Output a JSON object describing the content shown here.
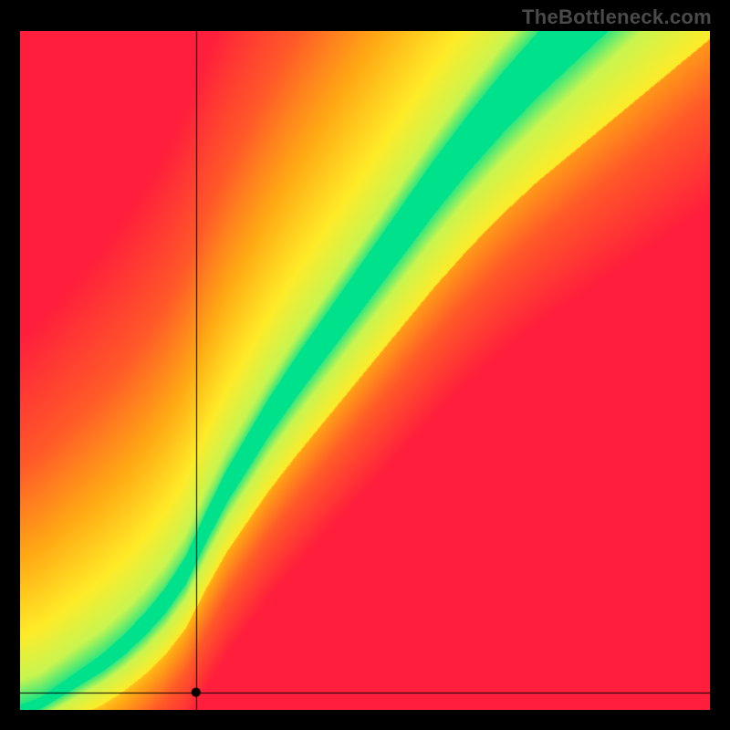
{
  "watermark": "TheBottleneck.com",
  "chart_data": {
    "type": "heatmap",
    "title": "",
    "xlabel": "",
    "ylabel": "",
    "xlim": [
      0,
      1
    ],
    "ylim": [
      0,
      1
    ],
    "optimal_curve_note": "Green ridge is the locus of ideal y for each x; surrounding gradient encodes distance from optimal (red far, yellow near, green at ridge).",
    "optimal_curve": [
      {
        "x": 0.0,
        "y": 0.0
      },
      {
        "x": 0.03,
        "y": 0.01
      },
      {
        "x": 0.06,
        "y": 0.03
      },
      {
        "x": 0.09,
        "y": 0.05
      },
      {
        "x": 0.12,
        "y": 0.07
      },
      {
        "x": 0.15,
        "y": 0.095
      },
      {
        "x": 0.18,
        "y": 0.125
      },
      {
        "x": 0.21,
        "y": 0.16
      },
      {
        "x": 0.24,
        "y": 0.205
      },
      {
        "x": 0.27,
        "y": 0.27
      },
      {
        "x": 0.3,
        "y": 0.33
      },
      {
        "x": 0.33,
        "y": 0.38
      },
      {
        "x": 0.36,
        "y": 0.43
      },
      {
        "x": 0.4,
        "y": 0.49
      },
      {
        "x": 0.45,
        "y": 0.56
      },
      {
        "x": 0.5,
        "y": 0.63
      },
      {
        "x": 0.55,
        "y": 0.7
      },
      {
        "x": 0.6,
        "y": 0.77
      },
      {
        "x": 0.65,
        "y": 0.835
      },
      {
        "x": 0.7,
        "y": 0.895
      },
      {
        "x": 0.75,
        "y": 0.95
      },
      {
        "x": 0.8,
        "y": 1.0
      }
    ],
    "ridge_half_width": [
      {
        "x": 0.0,
        "w": 0.007
      },
      {
        "x": 0.1,
        "w": 0.012
      },
      {
        "x": 0.2,
        "w": 0.018
      },
      {
        "x": 0.3,
        "w": 0.024
      },
      {
        "x": 0.4,
        "w": 0.03
      },
      {
        "x": 0.5,
        "w": 0.035
      },
      {
        "x": 0.6,
        "w": 0.04
      },
      {
        "x": 0.7,
        "w": 0.045
      },
      {
        "x": 0.8,
        "w": 0.05
      },
      {
        "x": 0.9,
        "w": 0.055
      },
      {
        "x": 1.0,
        "w": 0.06
      }
    ],
    "marker": {
      "x": 0.255,
      "y": 0.026
    },
    "crosshair": {
      "x": 0.255,
      "y": 0.026
    },
    "colorscale_note": "red -> orange -> yellow -> green with increasing proximity to ridge"
  }
}
